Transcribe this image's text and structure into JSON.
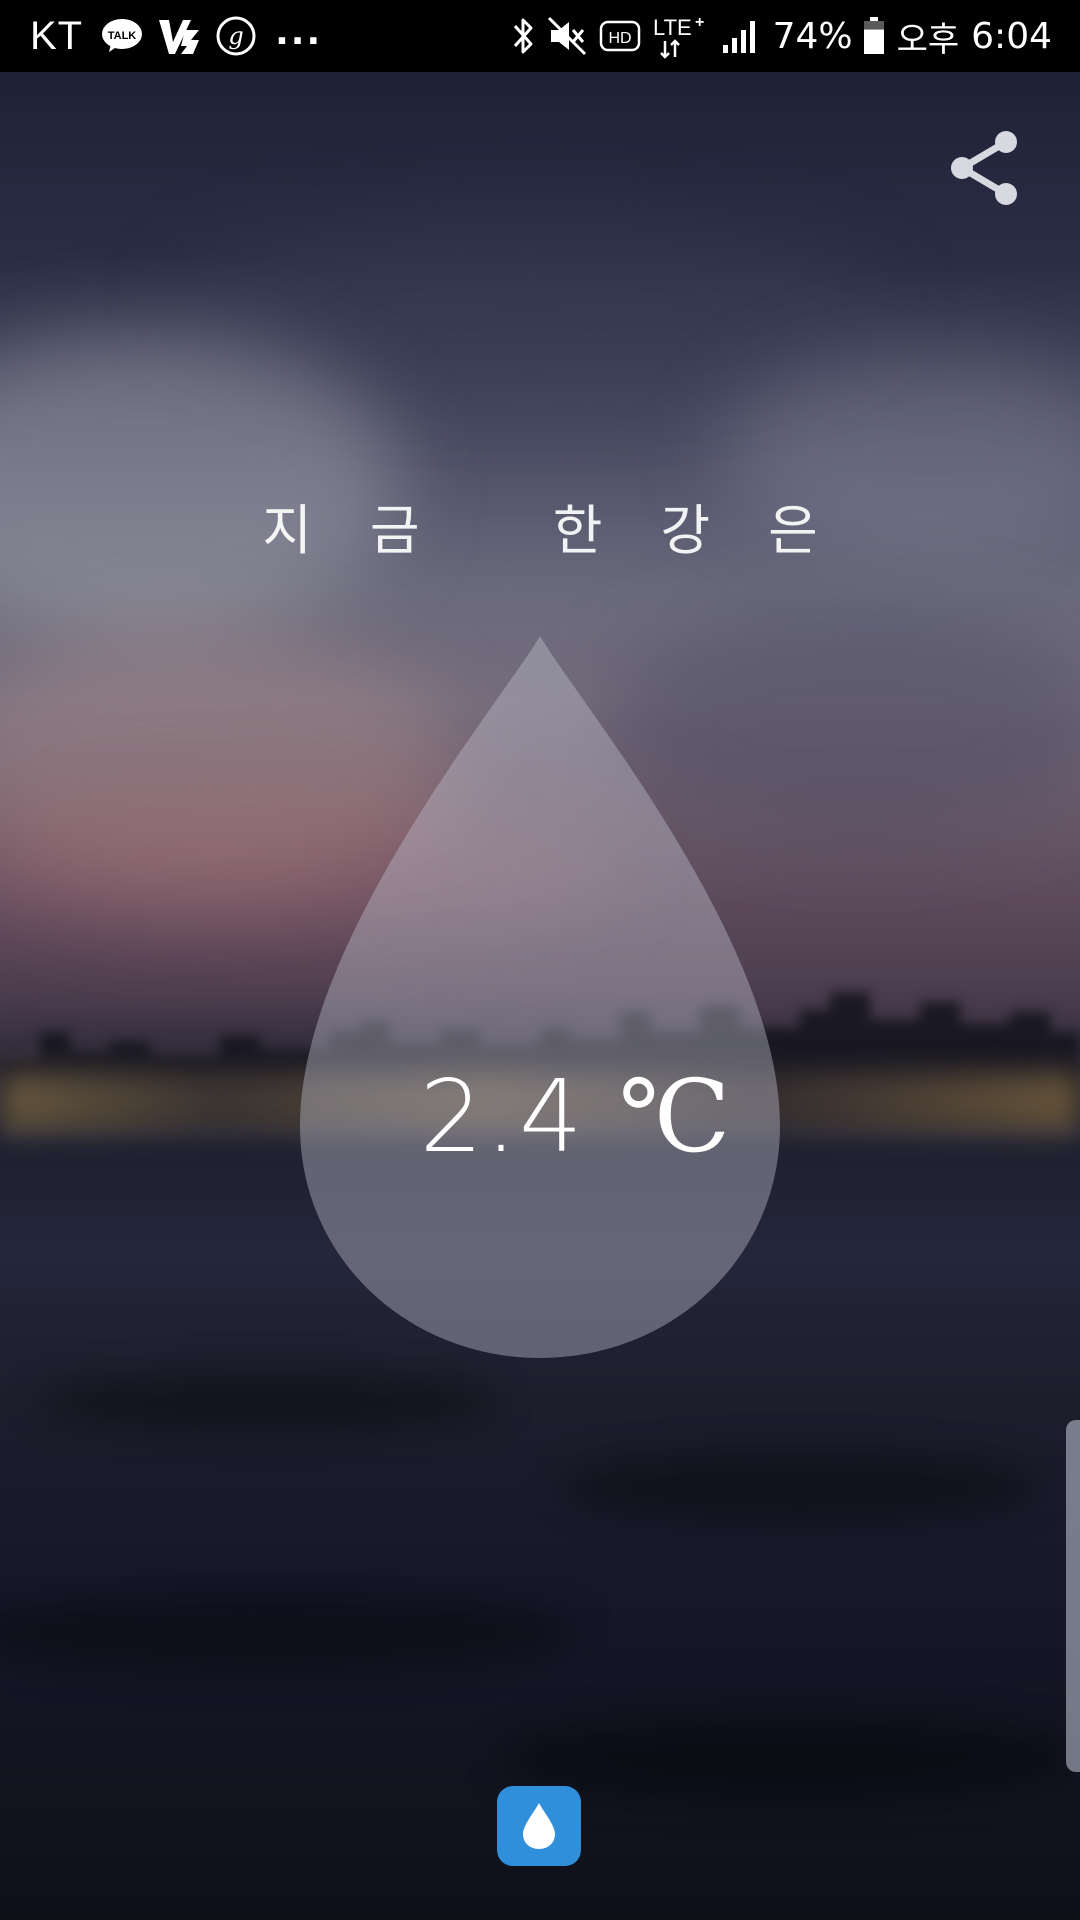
{
  "status_bar": {
    "carrier": "KT",
    "notification_icons": [
      "kakaotalk-icon",
      "v3-icon",
      "g-circle-icon"
    ],
    "more_indicator": "...",
    "system_icons": [
      "bluetooth-icon",
      "mute-icon",
      "hd-icon",
      "lte-plus-icon",
      "signal-icon"
    ],
    "hd_label": "HD",
    "lte_label": "LTE",
    "battery_percent": "74%",
    "battery_level": 0.74,
    "ampm": "오후",
    "time": "6:04"
  },
  "header": {
    "share_icon": "share-icon"
  },
  "main": {
    "title": "지금 한강은",
    "temperature_value": "2.4",
    "temperature_unit": "℃"
  },
  "bottom": {
    "drop_button_icon": "water-drop-icon",
    "drop_button_color": "#2f8fdb"
  },
  "colors": {
    "status_bar_bg": "#000000",
    "drop_fill": "rgba(190,190,200,0.45)",
    "text": "#ffffff"
  }
}
